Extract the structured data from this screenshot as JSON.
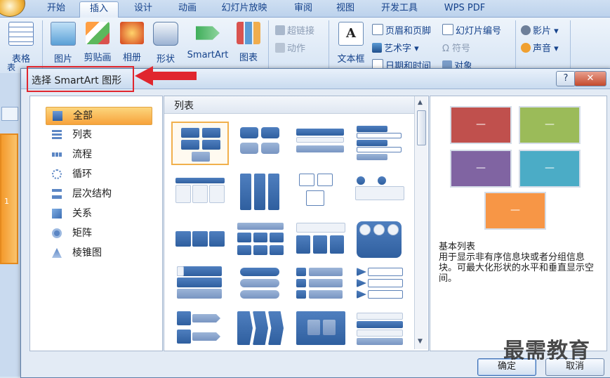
{
  "ribbon": {
    "tabs": [
      "开始",
      "插入",
      "设计",
      "动画",
      "幻灯片放映",
      "审阅",
      "视图",
      "开发工具",
      "WPS PDF"
    ],
    "active_tab": "插入",
    "big_buttons": [
      "表格",
      "图片",
      "剪贴画",
      "相册",
      "形状",
      "SmartArt",
      "图表",
      "文本框"
    ],
    "small_buttons": {
      "hyperlink": "超链接",
      "action": "动作",
      "header_footer": "页眉和页脚",
      "wordart": "艺术字",
      "date_time": "日期和时间",
      "slide_number": "幻灯片编号",
      "symbol": "符号",
      "object": "对象",
      "movie": "影片",
      "sound": "声音"
    },
    "group_label_partial": "表"
  },
  "slides_pane": {
    "slide_number": "1"
  },
  "dialog": {
    "title": "选择 SmartArt 图形",
    "help_label": "?",
    "close_label": "✕",
    "categories": [
      {
        "label": "全部",
        "icon": "all-layouts-icon",
        "selected": true
      },
      {
        "label": "列表",
        "icon": "list-icon",
        "selected": false
      },
      {
        "label": "流程",
        "icon": "process-icon",
        "selected": false
      },
      {
        "label": "循环",
        "icon": "cycle-icon",
        "selected": false
      },
      {
        "label": "层次结构",
        "icon": "hierarchy-icon",
        "selected": false
      },
      {
        "label": "关系",
        "icon": "relationship-icon",
        "selected": false
      },
      {
        "label": "矩阵",
        "icon": "matrix-icon",
        "selected": false
      },
      {
        "label": "棱锥图",
        "icon": "pyramid-icon",
        "selected": false
      }
    ],
    "gallery_header": "列表",
    "preview": {
      "name": "基本列表",
      "description": "用于显示非有序信息块或者分组信息块。可最大化形状的水平和垂直显示空间。",
      "block_dash": "—",
      "colors": [
        "#c0504d",
        "#9bbb59",
        "#8064a2",
        "#4bacc6",
        "#f79646"
      ]
    },
    "ok_label": "确定",
    "cancel_label": "取消"
  },
  "watermark": "最需教育"
}
